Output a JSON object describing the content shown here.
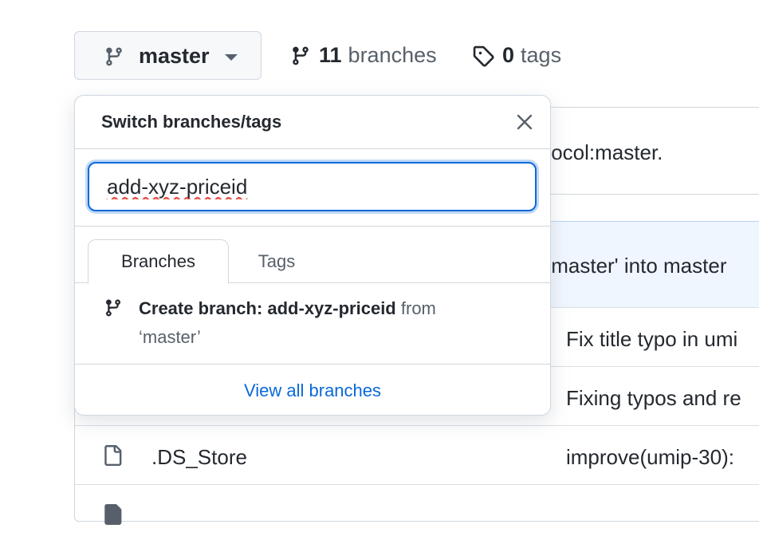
{
  "topbar": {
    "branch_button_label": "master",
    "branches_count": "11",
    "branches_label": "branches",
    "tags_count": "0",
    "tags_label": "tags"
  },
  "dropdown": {
    "title": "Switch branches/tags",
    "filter_value": "add-xyz-priceid",
    "tabs": [
      {
        "label": "Branches",
        "selected": true
      },
      {
        "label": "Tags",
        "selected": false
      }
    ],
    "create_bold": "Create branch: add-xyz-priceid",
    "create_from": "from",
    "create_source": "‘master’",
    "view_all": "View all branches"
  },
  "background": {
    "commit_banner": "tocol:master.",
    "merge_message": ":master' into master",
    "rows": [
      {
        "commit": "Fix title typo in umi"
      },
      {
        "commit": "Fixing typos and re"
      },
      {
        "name": ".DS_Store",
        "commit": "improve(umip-30):"
      }
    ]
  },
  "colors": {
    "accent": "#0969da",
    "border": "#d0d7de",
    "highlight_row": "#f0f6ff"
  },
  "icons": [
    "git-branch-icon",
    "caret-down-icon",
    "tag-icon",
    "close-icon",
    "file-icon"
  ]
}
